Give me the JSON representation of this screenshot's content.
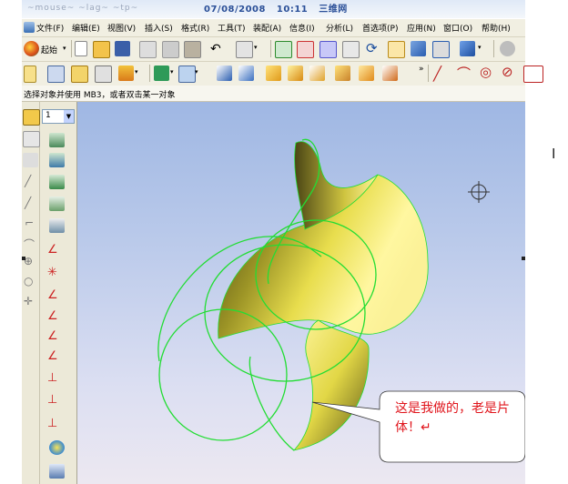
{
  "title_overlay": {
    "date": "07/08/2008",
    "time": "10:11",
    "site": "三维网",
    "ghost_text": "~mouse~ ~lag~ ~tp~"
  },
  "menubar": {
    "items": [
      "文件(F)",
      "编辑(E)",
      "视图(V)",
      "插入(S)",
      "格式(R)",
      "工具(T)",
      "装配(A)",
      "信息(I)",
      "分析(L)",
      "首选项(P)",
      "应用(N)",
      "窗口(O)",
      "帮助(H)"
    ]
  },
  "toolbar1": {
    "start_label": "起始"
  },
  "hint": {
    "text": "选择对象并使用 MB3，或者双击某一对象"
  },
  "layer_select": {
    "value": "1"
  },
  "callout": {
    "text": "这是我做的，老是片体！↵"
  },
  "colors": {
    "surface": "#e0d64a",
    "curves": "#22dd33",
    "callout_text": "#e0151c",
    "viewport_top": "#9fb7e3",
    "viewport_bottom": "#ece8f1"
  }
}
